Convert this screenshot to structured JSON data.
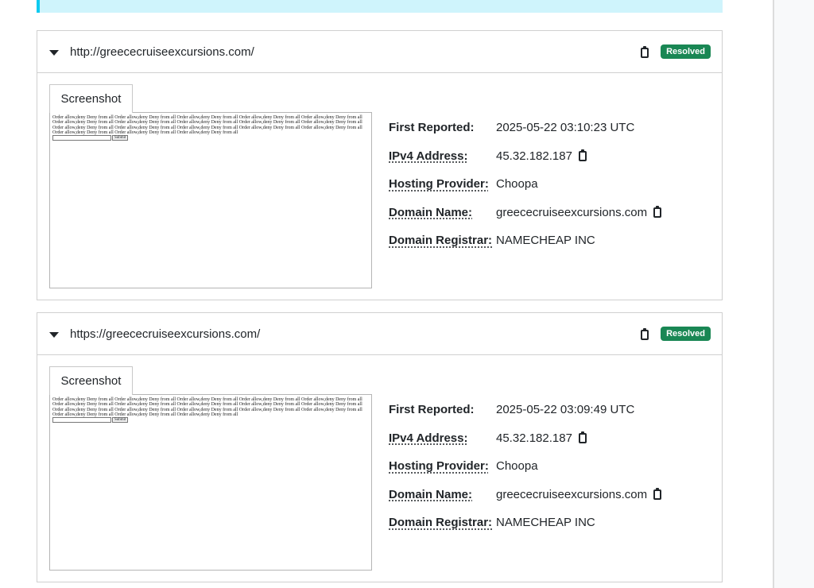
{
  "cards": [
    {
      "url": "http://greececruiseexcursions.com/",
      "badge": "Resolved",
      "tab_label": "Screenshot",
      "screenshot_text": "Order allow,deny Deny from all Order allow,deny Deny from all Order allow,deny Deny from all Order allow,deny Deny from all Order allow,deny Deny from all Order allow,deny Deny from all Order allow,deny Deny from all Order allow,deny Deny from all Order allow,deny Deny from all Order allow,deny Deny from all Order allow,deny Deny from all Order allow,deny Deny from all Order allow,deny Deny from all Order allow,deny Deny from all Order allow,deny Deny from all Order allow,deny Deny from all Order allow,deny Deny from all Order allow,deny Deny from all",
      "submit_label": "Submit",
      "first_reported_label": "First Reported:",
      "first_reported": "2025-05-22 03:10:23 UTC",
      "ipv4_label": "IPv4 Address:",
      "ipv4": "45.32.182.187",
      "hosting_label": "Hosting Provider:",
      "hosting": "Choopa",
      "domain_label": "Domain Name:",
      "domain": "greececruiseexcursions.com",
      "registrar_label": "Domain Registrar:",
      "registrar": "NAMECHEAP INC"
    },
    {
      "url": "https://greececruiseexcursions.com/",
      "badge": "Resolved",
      "tab_label": "Screenshot",
      "screenshot_text": "Order allow,deny Deny from all Order allow,deny Deny from all Order allow,deny Deny from all Order allow,deny Deny from all Order allow,deny Deny from all Order allow,deny Deny from all Order allow,deny Deny from all Order allow,deny Deny from all Order allow,deny Deny from all Order allow,deny Deny from all Order allow,deny Deny from all Order allow,deny Deny from all Order allow,deny Deny from all Order allow,deny Deny from all Order allow,deny Deny from all Order allow,deny Deny from all Order allow,deny Deny from all Order allow,deny Deny from all",
      "submit_label": "Submit",
      "first_reported_label": "First Reported:",
      "first_reported": "2025-05-22 03:09:49 UTC",
      "ipv4_label": "IPv4 Address:",
      "ipv4": "45.32.182.187",
      "hosting_label": "Hosting Provider:",
      "hosting": "Choopa",
      "domain_label": "Domain Name:",
      "domain": "greececruiseexcursions.com",
      "registrar_label": "Domain Registrar:",
      "registrar": "NAMECHEAP INC"
    }
  ],
  "icons": {
    "caret": "caret-down-icon",
    "copy": "clipboard-icon"
  },
  "colors": {
    "badge_resolved": "#198754",
    "alert_bg": "#cff4fc",
    "alert_border": "#0dcaf0"
  }
}
